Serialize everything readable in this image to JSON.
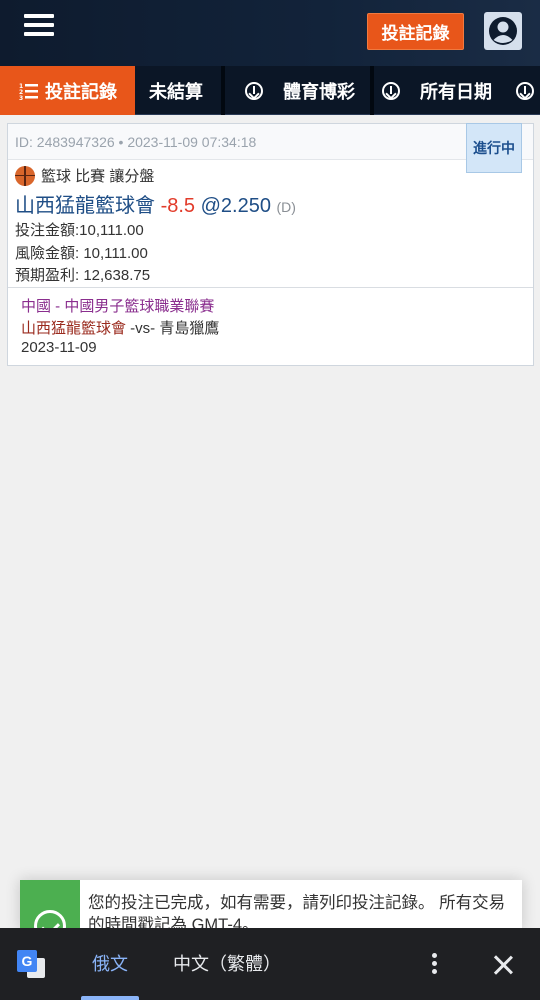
{
  "header": {
    "menu_icon": "hamburger-menu-icon",
    "record_button": "投註記錄",
    "user_icon": "user-account-icon"
  },
  "tabs": [
    {
      "label": "投註記錄",
      "icon": "list-icon",
      "active": true
    },
    {
      "label": "未結算",
      "icon": "chevron-down-circle-icon"
    },
    {
      "label": "體育博彩",
      "icon": "chevron-down-circle-icon"
    },
    {
      "label": "所有日期",
      "icon": "chevron-down-circle-icon"
    }
  ],
  "bet": {
    "id_line": "ID: 2483947326 • 2023-11-09 07:34:18",
    "status": "進行中",
    "sport_icon": "basketball-icon",
    "market": "籃球 比賽 讓分盤",
    "selection_team": "山西猛龍籃球會",
    "handicap": "-8.5",
    "odds": "@2.250",
    "odds_type": "(D)",
    "stake": "投注金額:10,111.00",
    "risk": "風險金額: 10,111.00",
    "expected_win": "預期盈利: 12,638.75",
    "league": "中國 - 中國男子籃球職業聯賽",
    "home_team": "山西猛龍籃球會",
    "vs_away": " -vs- 青島獵鷹",
    "match_date": "2023-11-09"
  },
  "toast": {
    "icon": "check-circle-icon",
    "text": "您的投注已完成，如有需要，請列印投注記錄。 所有交易的時間戳記為 GMT-4。"
  },
  "translate_bar": {
    "icon": "google-translate-icon",
    "lang_source": "俄文",
    "lang_target": "中文（繁體）",
    "colors": {
      "active": "#8ab4f8",
      "bg": "#1f2023"
    }
  },
  "colors": {
    "accent": "#e8561a",
    "navy": "#0e1b2e",
    "status_bg": "#d3e6f8",
    "handicap": "#e23b2a"
  }
}
